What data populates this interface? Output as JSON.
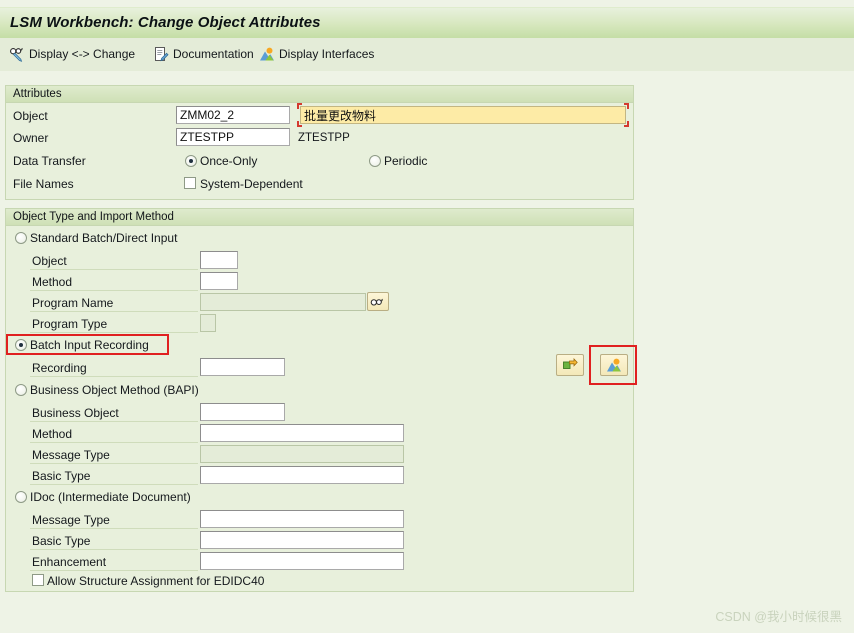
{
  "window": {
    "title": "LSM Workbench: Change Object Attributes"
  },
  "toolbar": {
    "items": [
      {
        "label": "Display <-> Change",
        "icon": "glasses-pencil-icon"
      },
      {
        "label": "Documentation",
        "icon": "document-pencil-icon"
      },
      {
        "label": "Display Interfaces",
        "icon": "mountain-picture-icon"
      }
    ]
  },
  "attributes": {
    "header": "Attributes",
    "object_label": "Object",
    "object_value": "ZMM02_2",
    "object_description": "批量更改物料",
    "owner_label": "Owner",
    "owner_value": "ZTESTPP",
    "owner_description": "ZTESTPP",
    "data_transfer_label": "Data Transfer",
    "data_transfer_once_only": "Once-Only",
    "data_transfer_once_only_selected": true,
    "data_transfer_periodic": "Periodic",
    "data_transfer_periodic_selected": false,
    "file_names_label": "File Names",
    "file_names_system_dependent": "System-Dependent",
    "file_names_system_dependent_checked": false
  },
  "object_type": {
    "header": "Object Type and Import Method",
    "standard_batch": {
      "label": "Standard Batch/Direct Input",
      "selected": false,
      "fields": [
        {
          "label": "Object",
          "value": "",
          "disabled": false
        },
        {
          "label": "Method",
          "value": "",
          "disabled": false
        },
        {
          "label": "Program Name",
          "value": "",
          "disabled": true
        },
        {
          "label": "Program Type",
          "value": "",
          "disabled": false
        }
      ],
      "search_help_icon": "glasses-search-icon"
    },
    "batch_input_recording": {
      "label": "Batch Input Recording",
      "selected": true,
      "fields": [
        {
          "label": "Recording",
          "value": "",
          "disabled": false
        }
      ],
      "buttons": [
        {
          "icon": "goto-recording-icon",
          "name": "goto-recording-button"
        },
        {
          "icon": "display-recording-icon",
          "name": "display-recording-button"
        }
      ]
    },
    "bapi": {
      "label": "Business Object Method  (BAPI)",
      "selected": false,
      "fields": [
        {
          "label": "Business Object",
          "value": "",
          "disabled": false
        },
        {
          "label": "Method",
          "value": "",
          "disabled": false
        },
        {
          "label": "Message Type",
          "value": "",
          "disabled": true
        },
        {
          "label": "Basic Type",
          "value": "",
          "disabled": false
        }
      ]
    },
    "idoc": {
      "label": "IDoc (Intermediate Document)",
      "selected": false,
      "fields": [
        {
          "label": "Message Type",
          "value": "",
          "disabled": false
        },
        {
          "label": "Basic Type",
          "value": "",
          "disabled": false
        },
        {
          "label": "Enhancement",
          "value": "",
          "disabled": false
        }
      ],
      "allow_structure_label": "Allow Structure Assignment for EDIDC40",
      "allow_structure_checked": false
    }
  },
  "watermark": {
    "text": "CSDN @我小时候很黑"
  },
  "colors": {
    "accent_green": "#c3dda4",
    "panel_bg": "#e8f0dc",
    "page_bg": "#eef3e6",
    "highlight_red": "#e02020",
    "focus_yellow": "#fdeba6"
  }
}
